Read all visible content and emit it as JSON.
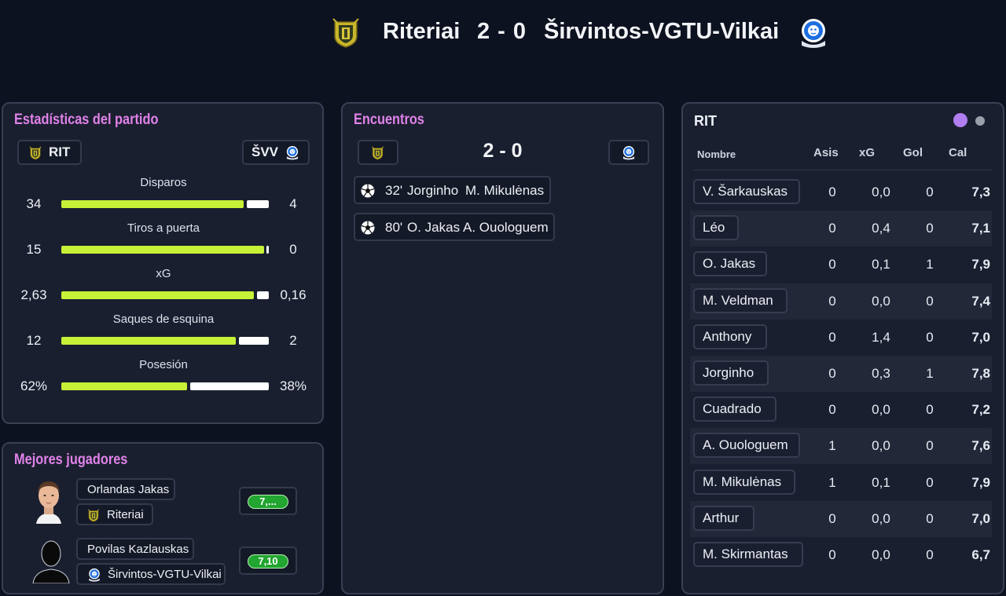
{
  "header": {
    "home_team": "Riteriai",
    "score": "2 - 0",
    "away_team": "Širvintos-VGTU-Vilkai",
    "home_crest_icon": "riteriai-crest-icon",
    "away_crest_icon": "lion-crest-icon"
  },
  "stats": {
    "title": "Estadísticas del partido",
    "home_abbr": "RIT",
    "away_abbr": "ŠVV",
    "rows": [
      {
        "label": "Disparos",
        "home": "34",
        "away": "4",
        "home_share": 0.895
      },
      {
        "label": "Tiros a puerta",
        "home": "15",
        "away": "0",
        "home_share": 1.0
      },
      {
        "label": "xG",
        "home": "2,63",
        "away": "0,16",
        "home_share": 0.943
      },
      {
        "label": "Saques de esquina",
        "home": "12",
        "away": "2",
        "home_share": 0.857
      },
      {
        "label": "Posesión",
        "home": "62%",
        "away": "38%",
        "home_share": 0.62
      }
    ]
  },
  "events": {
    "title": "Encuentros",
    "score": "2 - 0",
    "items": [
      {
        "minute": "32'",
        "scorer": "Jorginho",
        "assist": "M. Mikulėnas"
      },
      {
        "minute": "80'",
        "scorer": "O. Jakas",
        "assist": "A. Ouologuem"
      }
    ]
  },
  "best_players": {
    "title": "Mejores jugadores",
    "players": [
      {
        "name": "Orlandas Jakas",
        "team": "Riteriai",
        "rating": "7,..."
      },
      {
        "name": "Povilas Kazlauskas",
        "team": "Širvintos-VGTU-Vilkai",
        "rating": "7,10"
      }
    ]
  },
  "lineup": {
    "team": "RIT",
    "dot_active_color": "#b07ef0",
    "dot_inactive_color": "#9aa0ab",
    "columns": {
      "name": "Nombre",
      "assists": "Asis",
      "xg": "xG",
      "goals": "Gol",
      "rating": "Cal"
    },
    "players": [
      {
        "name": "V. Šarkauskas",
        "assists": "0",
        "xg": "0,0",
        "goals": "0",
        "rating": "7,3"
      },
      {
        "name": "Léo",
        "assists": "0",
        "xg": "0,4",
        "goals": "0",
        "rating": "7,1"
      },
      {
        "name": "O. Jakas",
        "assists": "0",
        "xg": "0,1",
        "goals": "1",
        "rating": "7,9"
      },
      {
        "name": "M. Veldman",
        "assists": "0",
        "xg": "0,0",
        "goals": "0",
        "rating": "7,4"
      },
      {
        "name": "Anthony",
        "assists": "0",
        "xg": "1,4",
        "goals": "0",
        "rating": "7,0"
      },
      {
        "name": "Jorginho",
        "assists": "0",
        "xg": "0,3",
        "goals": "1",
        "rating": "7,8"
      },
      {
        "name": "Cuadrado",
        "assists": "0",
        "xg": "0,0",
        "goals": "0",
        "rating": "7,2"
      },
      {
        "name": "A. Ouologuem",
        "assists": "1",
        "xg": "0,0",
        "goals": "0",
        "rating": "7,6"
      },
      {
        "name": "M. Mikulėnas",
        "assists": "1",
        "xg": "0,1",
        "goals": "0",
        "rating": "7,9"
      },
      {
        "name": "Arthur",
        "assists": "0",
        "xg": "0,0",
        "goals": "0",
        "rating": "7,0"
      },
      {
        "name": "M. Skirmantas",
        "assists": "0",
        "xg": "0,0",
        "goals": "0",
        "rating": "6,7"
      }
    ]
  }
}
